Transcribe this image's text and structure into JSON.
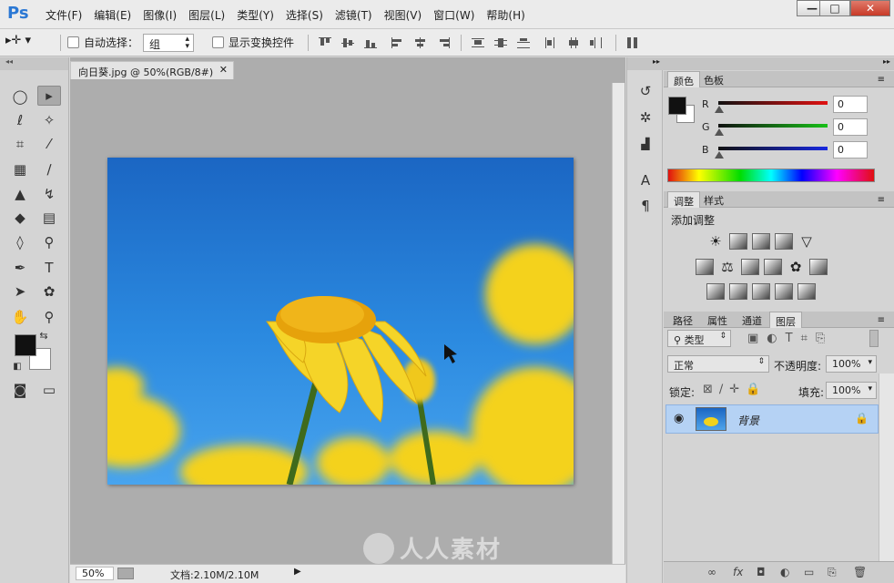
{
  "app": {
    "logo": "Ps"
  },
  "menu": {
    "items": [
      "文件(F)",
      "编辑(E)",
      "图像(I)",
      "图层(L)",
      "类型(Y)",
      "选择(S)",
      "滤镜(T)",
      "视图(V)",
      "窗口(W)",
      "帮助(H)"
    ]
  },
  "window_controls": {
    "minimize": "—",
    "maximize": "□",
    "close": "✕"
  },
  "options": {
    "auto_select_label": "自动选择：",
    "auto_select_checked": false,
    "auto_select_target": "组",
    "show_transform_label": "显示变换控件",
    "show_transform_checked": false
  },
  "document": {
    "tab_title": "向日葵.jpg @ 50%(RGB/8#)",
    "tab_close": "✕",
    "zoom": "50%",
    "doc_info": "文档:2.10M/2.10M",
    "status_arrow": "▶"
  },
  "watermark": {
    "text": "人人素材"
  },
  "color_panel": {
    "tabs": [
      "颜色",
      "色板"
    ],
    "channels": [
      {
        "label": "R",
        "value": "0",
        "color": "#d01010"
      },
      {
        "label": "G",
        "value": "0",
        "color": "#10a010"
      },
      {
        "label": "B",
        "value": "0",
        "color": "#1020c0"
      }
    ]
  },
  "adjust_panel": {
    "tabs": [
      "调整",
      "样式"
    ],
    "title": "添加调整"
  },
  "layers_panel": {
    "tabs": [
      "路径",
      "属性",
      "通道",
      "图层"
    ],
    "filter_kind": "类型",
    "blend_mode": "正常",
    "opacity_label": "不透明度:",
    "opacity_value": "100%",
    "lock_label": "锁定:",
    "fill_label": "填充:",
    "fill_value": "100%",
    "layers": [
      {
        "name": "背景",
        "visible": true,
        "locked": true
      }
    ]
  }
}
